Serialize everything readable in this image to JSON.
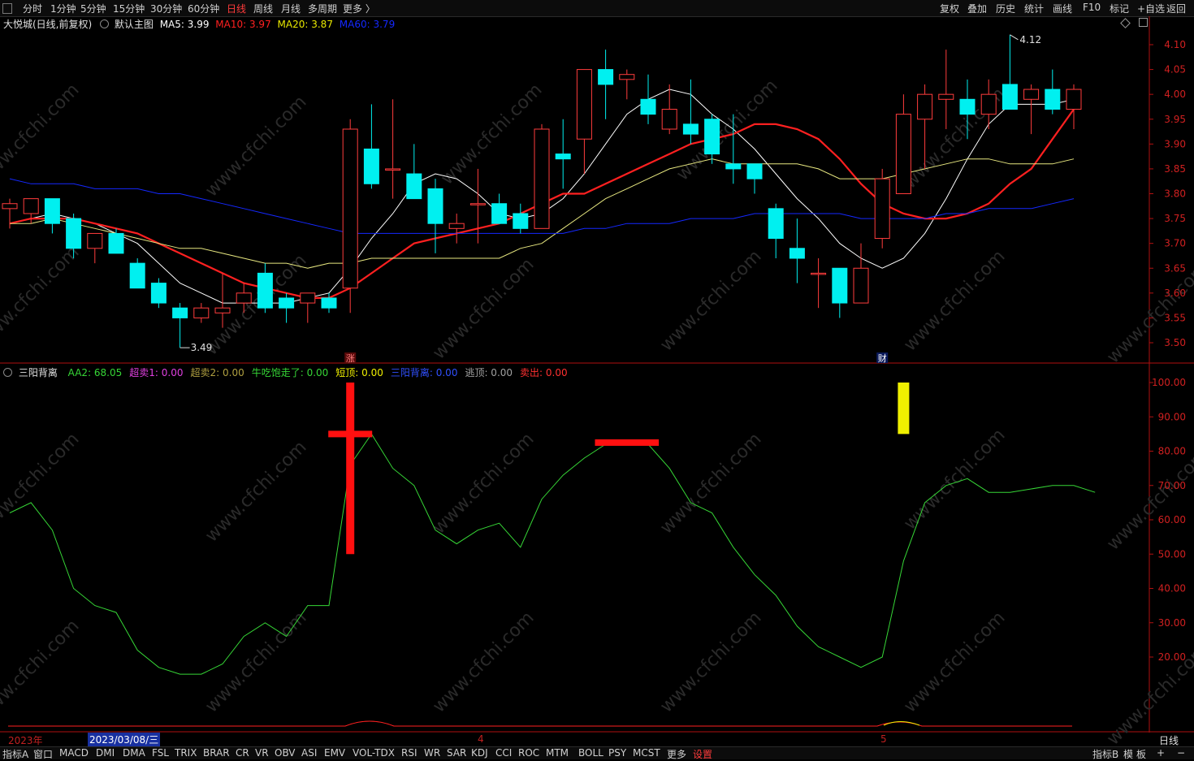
{
  "toolbar": {
    "periods": [
      "分时",
      "1分钟",
      "5分钟",
      "15分钟",
      "30分钟",
      "60分钟",
      "日线",
      "周线",
      "月线",
      "多周期",
      "更多 〉"
    ],
    "active_period": "日线",
    "right_buttons": [
      "复权",
      "叠加",
      "历史",
      "统计",
      "画线",
      "F10",
      "标记",
      "+自选",
      "返回"
    ]
  },
  "main_legend": {
    "stock": "大悦城(日线,前复权)",
    "template": "默认主图",
    "ma5": "MA5: 3.99",
    "ma10": "MA10: 3.97",
    "ma20": "MA20: 3.87",
    "ma60": "MA60: 3.79"
  },
  "sub_legend": {
    "name": "三阳背离",
    "items": [
      {
        "text": "AA2: 68.05",
        "color": "#36d636"
      },
      {
        "text": "超卖1: 0.00",
        "color": "#e040e0"
      },
      {
        "text": "超卖2: 0.00",
        "color": "#b0a040"
      },
      {
        "text": "牛吃饱走了: 0.00",
        "color": "#36d636"
      },
      {
        "text": "短顶: 0.00",
        "color": "#f0f000"
      },
      {
        "text": "三阳背离: 0.00",
        "color": "#3050ff"
      },
      {
        "text": "逃顶: 0.00",
        "color": "#a0a0a0"
      },
      {
        "text": "卖出: 0.00",
        "color": "#ff3030"
      }
    ]
  },
  "price_axis": [
    "4.10",
    "4.05",
    "4.00",
    "3.95",
    "3.90",
    "3.85",
    "3.80",
    "3.75",
    "3.70",
    "3.65",
    "3.60",
    "3.55",
    "3.50"
  ],
  "sub_axis": [
    "100.00",
    "90.00",
    "80.00",
    "70.00",
    "60.00",
    "50.00",
    "40.00",
    "30.00",
    "20.00"
  ],
  "annotations": {
    "high_label": "4.12",
    "low_label": "3.49",
    "zhang_mark": "涨",
    "cai_mark": "财"
  },
  "date_strip": {
    "year": "2023年",
    "cursor_date": "2023/03/08/三",
    "month4": "4",
    "month5": "5",
    "period_right": "日线"
  },
  "bottom_tabs": [
    "指标A",
    "窗口",
    "MACD",
    "DMI",
    "DMA",
    "FSL",
    "TRIX",
    "BRAR",
    "CR",
    "VR",
    "OBV",
    "ASI",
    "EMV",
    "VOL-TDX",
    "RSI",
    "WR",
    "SAR",
    "KDJ",
    "CCI",
    "ROC",
    "MTM",
    "BOLL",
    "PSY",
    "MCST",
    "更多",
    "设置"
  ],
  "bottom_right": [
    "指标B",
    "模",
    "板",
    "+",
    "−"
  ],
  "watermark": "www.cfchi.com",
  "colors": {
    "up": "#ff3c3c",
    "down": "#00f0f0",
    "ma5": "#ffffff",
    "ma10": "#ff2020",
    "ma20": "#e8e880",
    "ma60": "#1428ff",
    "aa2": "#36d636",
    "axis_text": "#d02020"
  },
  "chart_data": [
    {
      "type": "candlestick",
      "title": "大悦城(日线,前复权)",
      "ylim": [
        3.47,
        4.135
      ],
      "ohlc": [
        [
          3.77,
          3.79,
          3.73,
          3.78
        ],
        [
          3.76,
          3.79,
          3.74,
          3.79
        ],
        [
          3.79,
          3.79,
          3.72,
          3.74
        ],
        [
          3.75,
          3.76,
          3.67,
          3.69
        ],
        [
          3.69,
          3.72,
          3.66,
          3.72
        ],
        [
          3.72,
          3.73,
          3.68,
          3.68
        ],
        [
          3.66,
          3.67,
          3.61,
          3.61
        ],
        [
          3.62,
          3.63,
          3.57,
          3.58
        ],
        [
          3.57,
          3.58,
          3.49,
          3.55
        ],
        [
          3.55,
          3.58,
          3.54,
          3.57
        ],
        [
          3.56,
          3.64,
          3.53,
          3.57
        ],
        [
          3.58,
          3.62,
          3.56,
          3.6
        ],
        [
          3.64,
          3.66,
          3.56,
          3.57
        ],
        [
          3.59,
          3.6,
          3.54,
          3.57
        ],
        [
          3.58,
          3.6,
          3.54,
          3.6
        ],
        [
          3.59,
          3.6,
          3.56,
          3.57
        ],
        [
          3.61,
          3.95,
          3.56,
          3.93
        ],
        [
          3.89,
          3.98,
          3.81,
          3.82
        ],
        [
          3.85,
          3.99,
          3.79,
          3.85
        ],
        [
          3.84,
          3.9,
          3.8,
          3.79
        ],
        [
          3.81,
          3.83,
          3.68,
          3.74
        ],
        [
          3.73,
          3.76,
          3.7,
          3.74
        ],
        [
          3.78,
          3.85,
          3.7,
          3.78
        ],
        [
          3.78,
          3.8,
          3.75,
          3.74
        ],
        [
          3.76,
          3.78,
          3.72,
          3.73
        ],
        [
          3.73,
          3.94,
          3.73,
          3.93
        ],
        [
          3.88,
          3.95,
          3.81,
          3.87
        ],
        [
          3.91,
          4.05,
          3.84,
          4.05
        ],
        [
          4.05,
          4.09,
          3.95,
          4.02
        ],
        [
          4.03,
          4.05,
          3.99,
          4.04
        ],
        [
          3.99,
          4.04,
          3.94,
          3.96
        ],
        [
          3.93,
          4.02,
          3.92,
          3.97
        ],
        [
          3.94,
          4.03,
          3.9,
          3.92
        ],
        [
          3.95,
          3.96,
          3.86,
          3.88
        ],
        [
          3.86,
          3.96,
          3.82,
          3.85
        ],
        [
          3.86,
          3.86,
          3.8,
          3.83
        ],
        [
          3.77,
          3.78,
          3.67,
          3.71
        ],
        [
          3.69,
          3.75,
          3.62,
          3.67
        ],
        [
          3.64,
          3.67,
          3.57,
          3.64
        ],
        [
          3.65,
          3.65,
          3.55,
          3.58
        ],
        [
          3.58,
          3.7,
          3.58,
          3.65
        ],
        [
          3.71,
          3.85,
          3.69,
          3.83
        ],
        [
          3.8,
          4.0,
          3.8,
          3.96
        ],
        [
          3.95,
          4.02,
          3.85,
          4.0
        ],
        [
          3.99,
          4.09,
          3.93,
          4.0
        ],
        [
          3.99,
          4.03,
          3.91,
          3.96
        ],
        [
          3.96,
          4.03,
          3.93,
          4.0
        ],
        [
          4.02,
          4.12,
          3.97,
          3.97
        ],
        [
          3.99,
          4.02,
          3.92,
          4.01
        ],
        [
          4.01,
          4.05,
          3.96,
          3.97
        ],
        [
          3.97,
          4.02,
          3.93,
          4.01
        ]
      ],
      "series": [
        {
          "name": "MA5",
          "values": [
            3.74,
            3.75,
            3.76,
            3.75,
            3.74,
            3.72,
            3.7,
            3.66,
            3.62,
            3.6,
            3.58,
            3.58,
            3.58,
            3.58,
            3.59,
            3.6,
            3.65,
            3.71,
            3.76,
            3.82,
            3.84,
            3.83,
            3.8,
            3.76,
            3.75,
            3.76,
            3.79,
            3.84,
            3.9,
            3.96,
            3.99,
            4.01,
            4.0,
            3.96,
            3.93,
            3.89,
            3.84,
            3.79,
            3.75,
            3.7,
            3.67,
            3.65,
            3.67,
            3.72,
            3.79,
            3.87,
            3.94,
            3.98,
            3.98,
            3.98,
            3.99
          ]
        },
        {
          "name": "MA10",
          "values": [
            3.74,
            3.75,
            3.75,
            3.75,
            3.74,
            3.73,
            3.72,
            3.7,
            3.68,
            3.66,
            3.64,
            3.62,
            3.61,
            3.6,
            3.59,
            3.59,
            3.61,
            3.64,
            3.67,
            3.7,
            3.71,
            3.72,
            3.73,
            3.74,
            3.76,
            3.78,
            3.8,
            3.8,
            3.82,
            3.84,
            3.86,
            3.88,
            3.9,
            3.91,
            3.92,
            3.94,
            3.94,
            3.93,
            3.91,
            3.87,
            3.82,
            3.78,
            3.76,
            3.75,
            3.75,
            3.76,
            3.78,
            3.82,
            3.85,
            3.91,
            3.97
          ]
        },
        {
          "name": "MA20",
          "values": [
            3.74,
            3.74,
            3.75,
            3.74,
            3.73,
            3.72,
            3.71,
            3.7,
            3.69,
            3.69,
            3.68,
            3.67,
            3.66,
            3.66,
            3.65,
            3.66,
            3.66,
            3.67,
            3.67,
            3.67,
            3.67,
            3.67,
            3.67,
            3.67,
            3.69,
            3.7,
            3.73,
            3.76,
            3.79,
            3.81,
            3.83,
            3.85,
            3.86,
            3.87,
            3.86,
            3.86,
            3.86,
            3.86,
            3.85,
            3.83,
            3.83,
            3.83,
            3.84,
            3.85,
            3.86,
            3.87,
            3.87,
            3.86,
            3.86,
            3.86,
            3.87
          ]
        },
        {
          "name": "MA60",
          "values": [
            3.83,
            3.82,
            3.82,
            3.82,
            3.81,
            3.81,
            3.81,
            3.8,
            3.8,
            3.79,
            3.78,
            3.77,
            3.76,
            3.75,
            3.74,
            3.73,
            3.72,
            3.72,
            3.72,
            3.72,
            3.72,
            3.72,
            3.72,
            3.72,
            3.72,
            3.72,
            3.72,
            3.73,
            3.73,
            3.74,
            3.74,
            3.74,
            3.75,
            3.75,
            3.75,
            3.76,
            3.76,
            3.76,
            3.76,
            3.76,
            3.75,
            3.75,
            3.75,
            3.75,
            3.76,
            3.76,
            3.77,
            3.77,
            3.77,
            3.78,
            3.79
          ]
        }
      ]
    },
    {
      "type": "line",
      "title": "三阳背离",
      "ylim": [
        0,
        105
      ],
      "series": [
        {
          "name": "AA2",
          "values": [
            62,
            65,
            57,
            40,
            35,
            33,
            22,
            17,
            15,
            15,
            18,
            26,
            30,
            26,
            35,
            35,
            76,
            85,
            75,
            70,
            57,
            53,
            57,
            59,
            52,
            66,
            73,
            78,
            82,
            82,
            82,
            75,
            65,
            62,
            52,
            44,
            38,
            29,
            23,
            20,
            17,
            20,
            48,
            65,
            70,
            72,
            68,
            68,
            69,
            70,
            70,
            68
          ]
        }
      ],
      "markers": [
        {
          "type": "cross",
          "x_index": 16,
          "y_from": 50,
          "y_to": 100,
          "bar_y": 85,
          "color": "#ff1010"
        },
        {
          "type": "bar",
          "x_from": 27.5,
          "x_to": 30.5,
          "y": 82.5,
          "color": "#ff1010"
        },
        {
          "type": "column",
          "x_index": 42,
          "y_from": 85,
          "y_to": 100,
          "color": "#f0f000"
        }
      ]
    }
  ]
}
